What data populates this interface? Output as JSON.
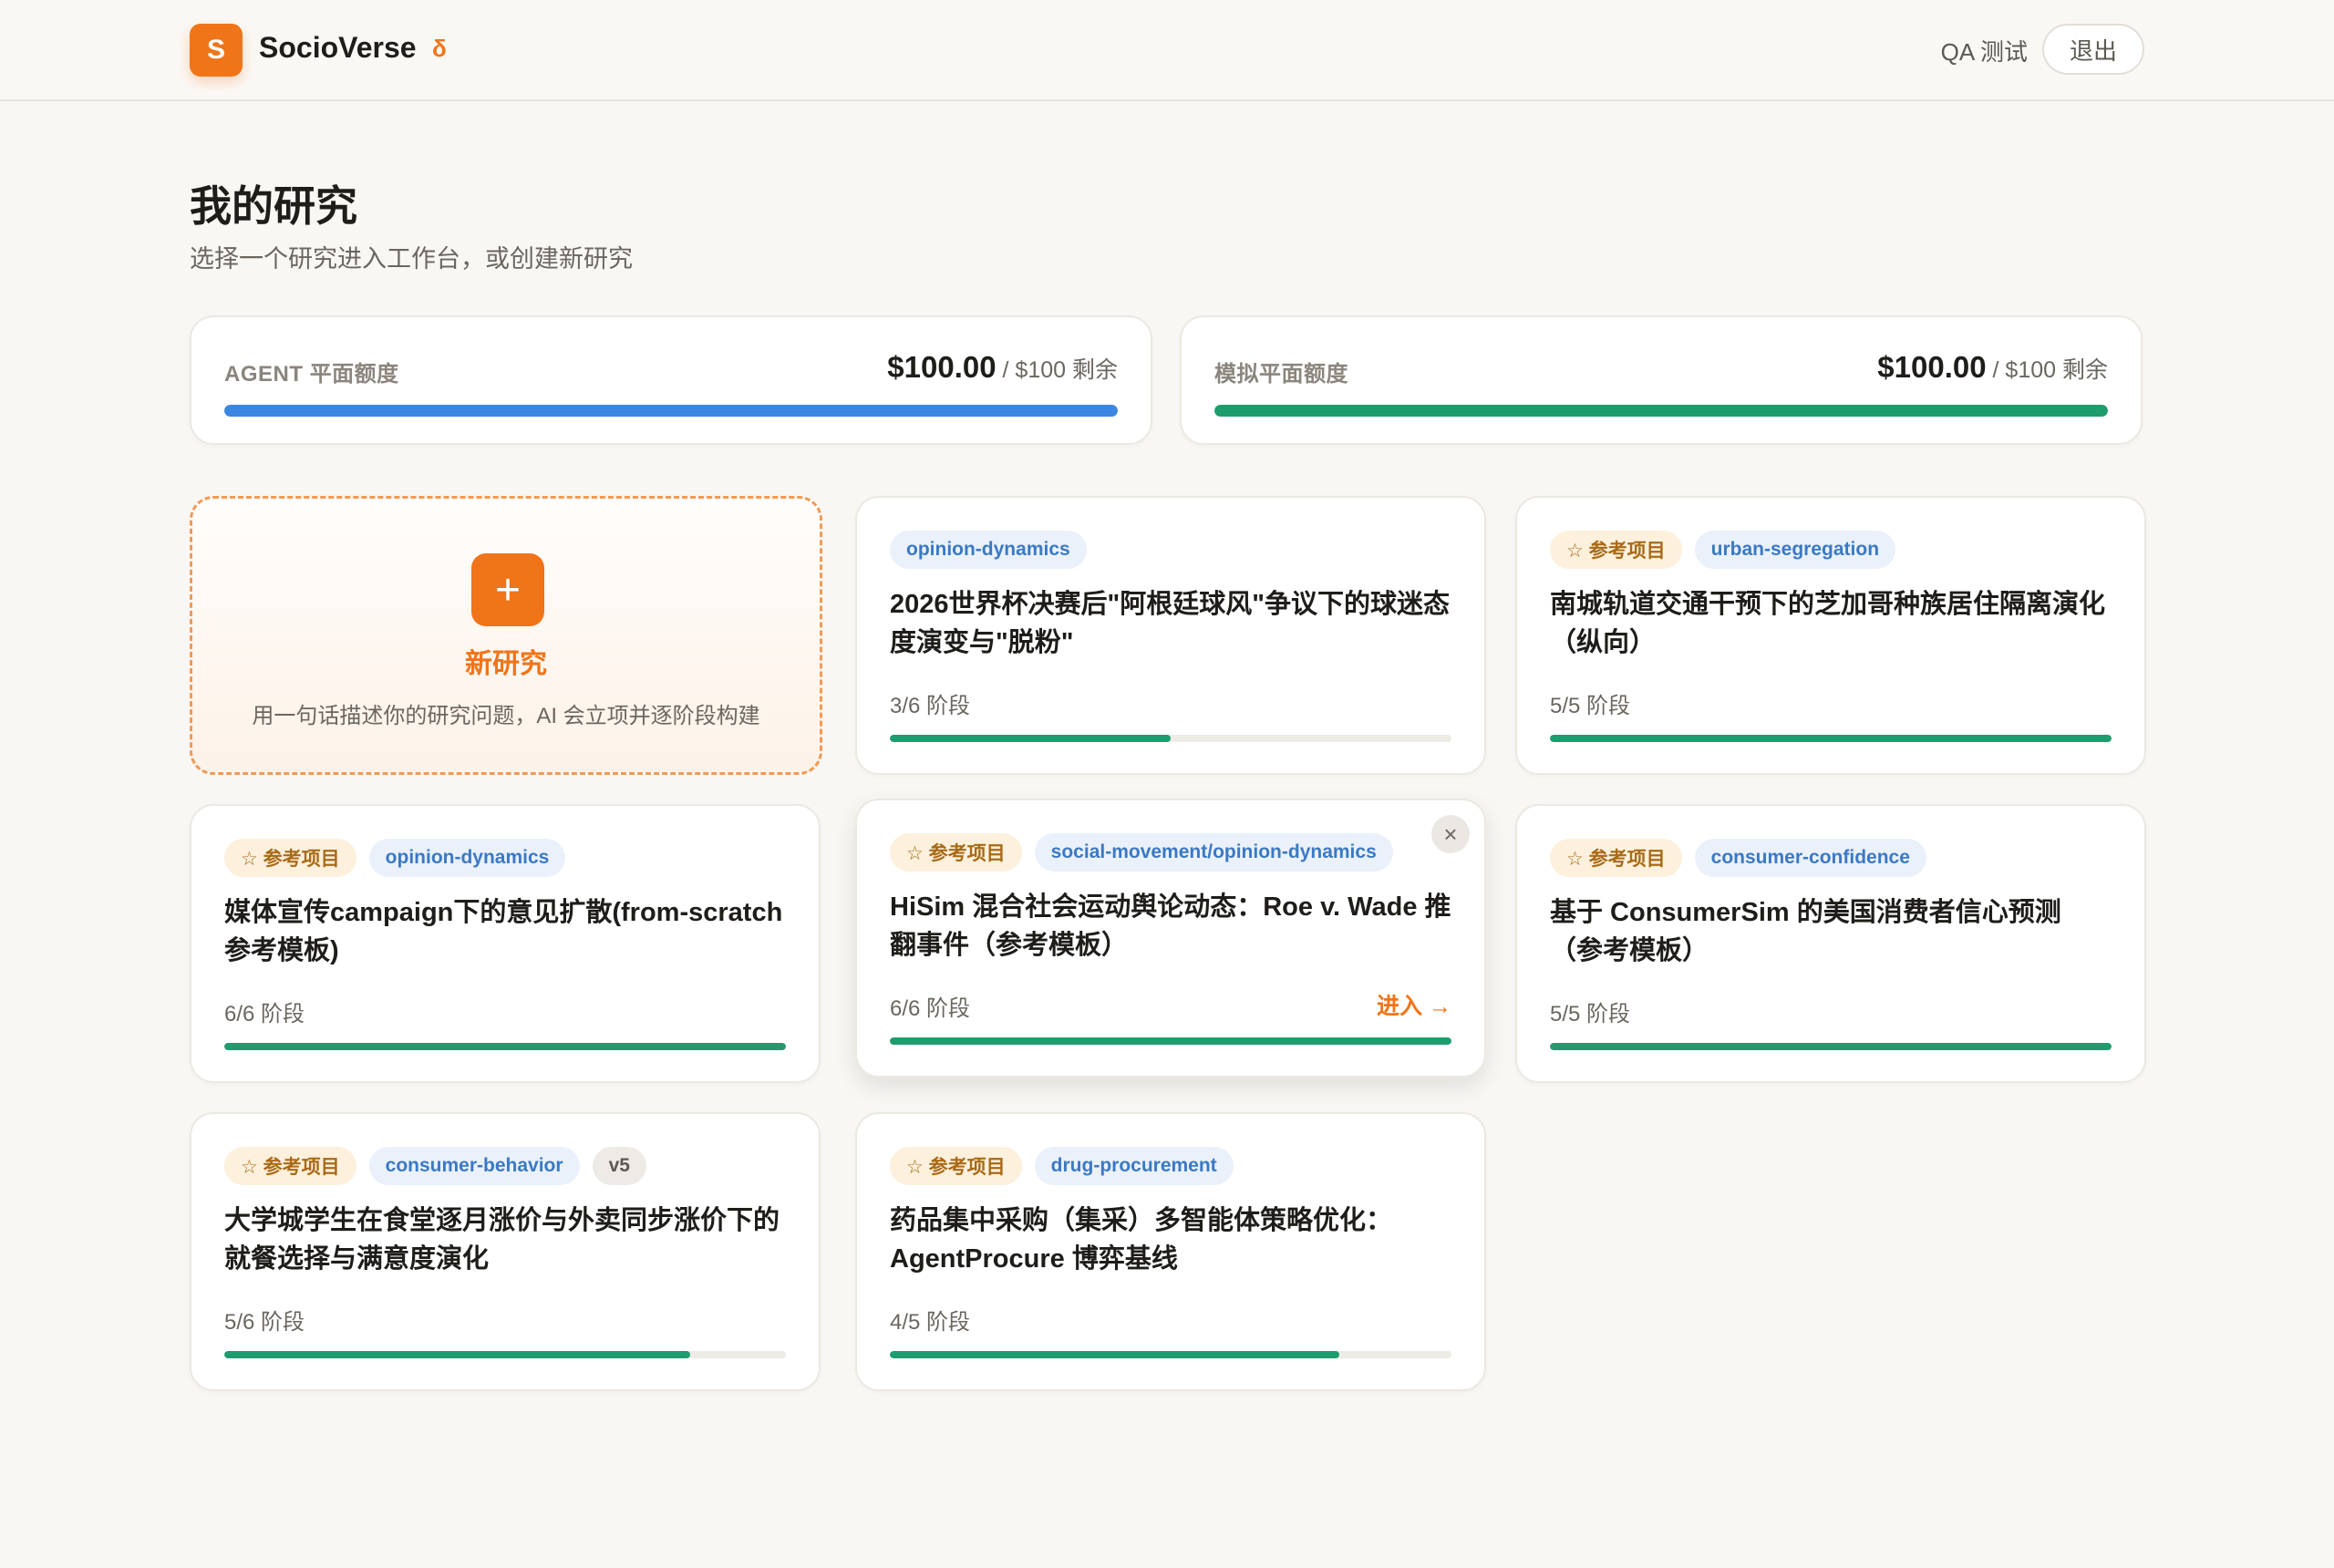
{
  "header": {
    "logo_letter": "S",
    "brand": "SocioVerse",
    "version": "δ",
    "user": "QA 测试",
    "logout_label": "退出"
  },
  "page": {
    "title": "我的研究",
    "subtitle": "选择一个研究进入工作台，或创建新研究"
  },
  "quotas": [
    {
      "label": "AGENT 平面额度",
      "amount": "$100.00",
      "suffix": " / $100 剩余",
      "fraction": 1.0,
      "color": "#3b86e0"
    },
    {
      "label": "模拟平面额度",
      "amount": "$100.00",
      "suffix": " / $100 剩余",
      "fraction": 1.0,
      "color": "#1f9c6e"
    }
  ],
  "new_research": {
    "icon": "+",
    "title": "新研究",
    "description": "用一句话描述你的研究问题，AI 会立项并逐阶段构建"
  },
  "projects": [
    {
      "tags": [
        {
          "type": "topic",
          "text": "opinion-dynamics"
        }
      ],
      "title": "2026世界杯决赛后\"阿根廷球风\"争议下的球迷态度演变与\"脱粉\"",
      "stage": "3/6 阶段",
      "progress": 0.5
    },
    {
      "tags": [
        {
          "type": "ref",
          "text": "☆ 参考项目"
        },
        {
          "type": "topic",
          "text": "urban-segregation"
        }
      ],
      "title": "南城轨道交通干预下的芝加哥种族居住隔离演化（纵向）",
      "stage": "5/5 阶段",
      "progress": 1.0
    },
    {
      "tags": [
        {
          "type": "ref",
          "text": "☆ 参考项目"
        },
        {
          "type": "topic",
          "text": "opinion-dynamics"
        }
      ],
      "title": "媒体宣传campaign下的意见扩散(from-scratch 参考模板)",
      "stage": "6/6 阶段",
      "progress": 1.0
    },
    {
      "tags": [
        {
          "type": "ref",
          "text": "☆ 参考项目"
        },
        {
          "type": "topic",
          "text": "social-movement/opinion-dynamics"
        }
      ],
      "title": "HiSim 混合社会运动舆论动态：Roe v. Wade 推翻事件（参考模板）",
      "stage": "6/6 阶段",
      "progress": 1.0,
      "enter_label": "进入 →",
      "close_icon": "×"
    },
    {
      "tags": [
        {
          "type": "ref",
          "text": "☆ 参考项目"
        },
        {
          "type": "topic",
          "text": "consumer-confidence"
        }
      ],
      "title": "基于 ConsumerSim 的美国消费者信心预测（参考模板）",
      "stage": "5/5 阶段",
      "progress": 1.0
    },
    {
      "tags": [
        {
          "type": "ref",
          "text": "☆ 参考项目"
        },
        {
          "type": "topic",
          "text": "consumer-behavior"
        },
        {
          "type": "ver",
          "text": "v5"
        }
      ],
      "title": "大学城学生在食堂逐月涨价与外卖同步涨价下的就餐选择与满意度演化",
      "stage": "5/6 阶段",
      "progress": 0.83
    },
    {
      "tags": [
        {
          "type": "ref",
          "text": "☆ 参考项目"
        },
        {
          "type": "topic",
          "text": "drug-procurement"
        }
      ],
      "title": "药品集中采购（集采）多智能体策略优化：AgentProcure 博弈基线",
      "stage": "4/5 阶段",
      "progress": 0.8
    }
  ]
}
